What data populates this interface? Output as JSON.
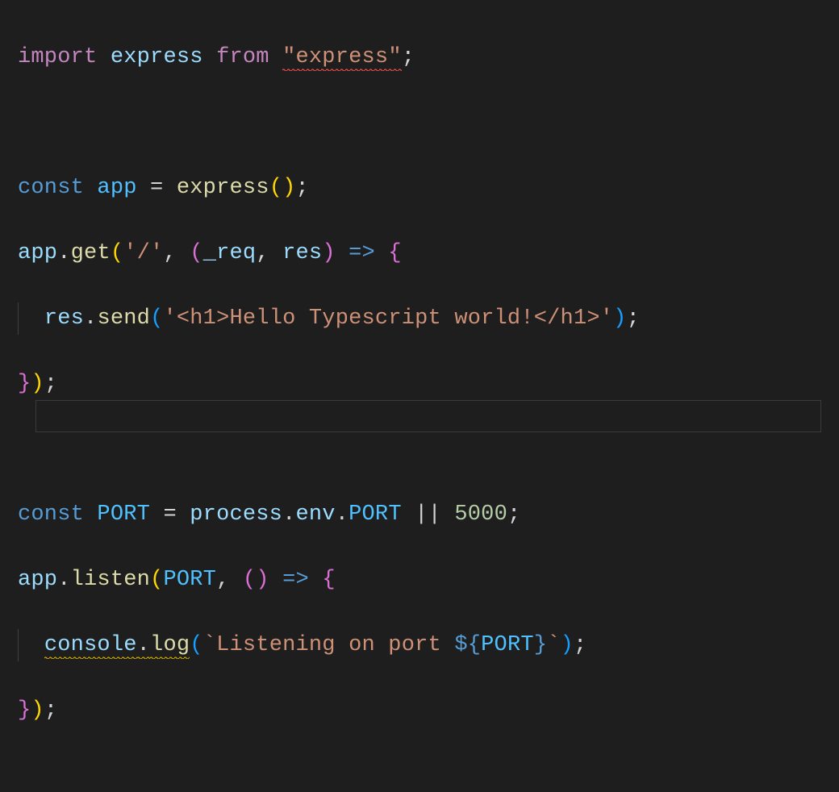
{
  "editor": {
    "language": "typescript",
    "theme": "dark-plus",
    "lines": {
      "l1": {
        "import": "import",
        "express_ident": "express",
        "from": "from",
        "express_string": "\"express\"",
        "semi": ";"
      },
      "l3": {
        "const": "const",
        "app": "app",
        "eq": "=",
        "express_call": "express",
        "parens": "()",
        "semi": ";"
      },
      "l4": {
        "app": "app",
        "dot": ".",
        "get": "get",
        "open": "(",
        "route": "'/'",
        "comma": ",",
        "open2": "(",
        "req": "_req",
        "comma2": ",",
        "res": "res",
        "close2": ")",
        "arrow": "=>",
        "brace": "{"
      },
      "l5": {
        "res": "res",
        "dot": ".",
        "send": "send",
        "open": "(",
        "html": "'<h1>Hello Typescript world!</h1>'",
        "close": ")",
        "semi": ";"
      },
      "l6": {
        "brace": "}",
        "close": ")",
        "semi": ";"
      },
      "l8": {
        "const": "const",
        "port": "PORT",
        "eq": "=",
        "process": "process",
        "dot1": ".",
        "env": "env",
        "dot2": ".",
        "port2": "PORT",
        "or": "||",
        "num": "5000",
        "semi": ";"
      },
      "l9": {
        "app": "app",
        "dot": ".",
        "listen": "listen",
        "open": "(",
        "port": "PORT",
        "comma": ",",
        "open2": "(",
        "close2": ")",
        "arrow": "=>",
        "brace": "{"
      },
      "l10": {
        "console": "console",
        "dot": ".",
        "log": "log",
        "open": "(",
        "tmpl_open": "`",
        "text": "Listening on port ",
        "interp_open": "${",
        "port": "PORT",
        "interp_close": "}",
        "tmpl_close": "`",
        "close": ")",
        "semi": ";"
      },
      "l11": {
        "brace": "}",
        "close": ")",
        "semi": ";"
      }
    },
    "diagnostics": {
      "express_module": "error",
      "console_stmt": "warning"
    }
  }
}
